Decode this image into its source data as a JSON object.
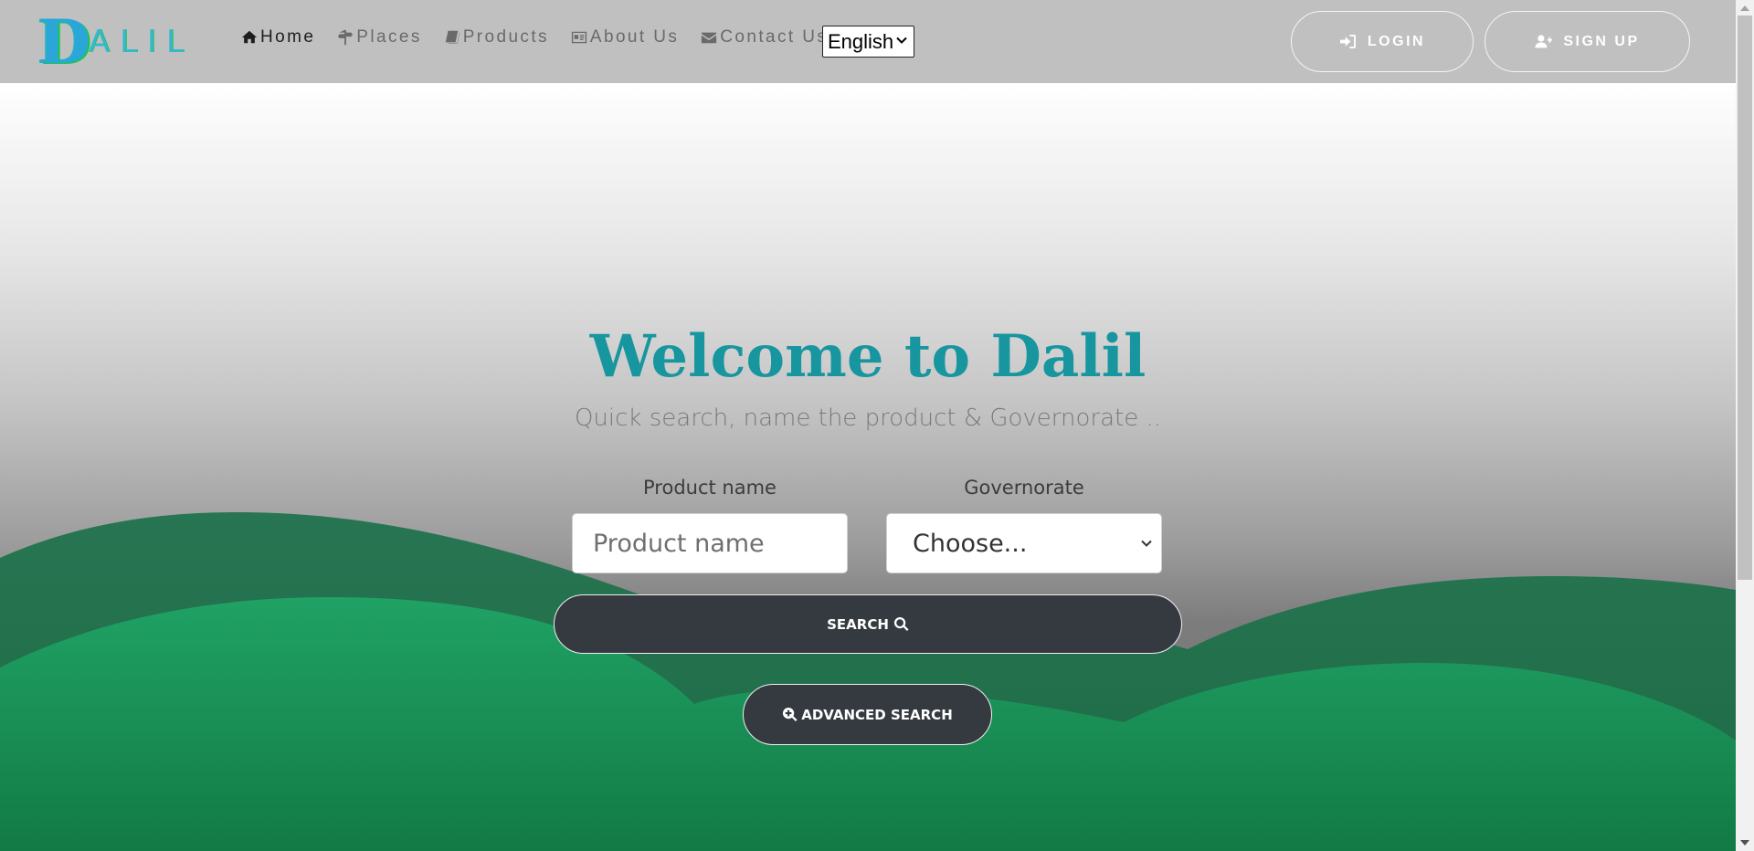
{
  "brand": {
    "logo_text": "ALIL",
    "logo_initial": "D"
  },
  "nav": {
    "items": [
      {
        "label": "Home",
        "icon": "home-icon",
        "active": true
      },
      {
        "label": "Places",
        "icon": "signpost-icon",
        "active": false
      },
      {
        "label": "Products",
        "icon": "book-icon",
        "active": false
      },
      {
        "label": "About Us",
        "icon": "id-card-icon",
        "active": false
      },
      {
        "label": "Contact Us",
        "icon": "envelope-icon",
        "active": false
      }
    ],
    "language": "English"
  },
  "auth": {
    "login_label": "LOGIN",
    "signup_label": "SIGN UP"
  },
  "hero": {
    "title": "Welcome to Dalil",
    "subtitle": "Quick search, name the product & Governorate ..",
    "product_label": "Product name",
    "product_placeholder": "Product name",
    "governorate_label": "Governorate",
    "governorate_selected": "Choose...",
    "search_label": "SEARCH",
    "advanced_label": "ADVANCED SEARCH"
  },
  "colors": {
    "navbar": "#c0c0c0",
    "title": "#17969f",
    "button_dark": "#343a40",
    "hill_dark": "#247350",
    "hill_light": "#1e9a5e"
  }
}
